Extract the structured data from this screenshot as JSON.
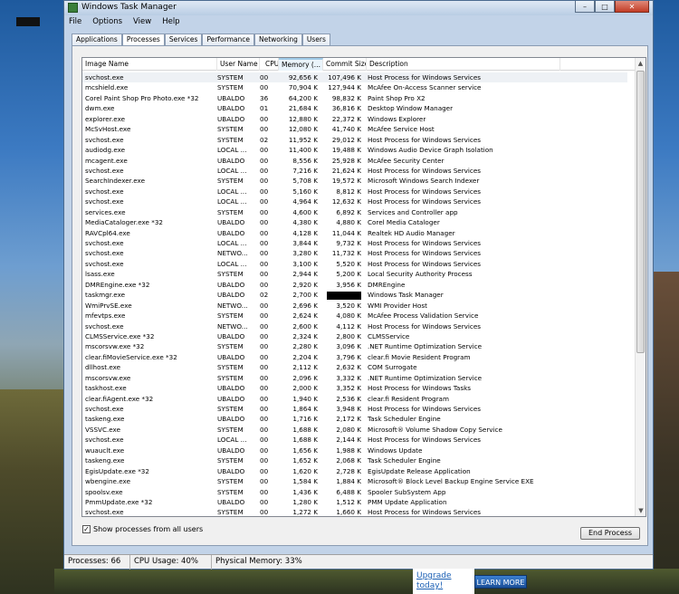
{
  "window": {
    "title": "Windows Task Manager"
  },
  "menu": [
    "File",
    "Options",
    "View",
    "Help"
  ],
  "tabs": [
    "Applications",
    "Processes",
    "Services",
    "Performance",
    "Networking",
    "Users"
  ],
  "active_tab": "Processes",
  "columns": [
    "Image Name",
    "User Name",
    "CPU",
    "Memory (...",
    "Commit Size",
    "Description"
  ],
  "processes": [
    {
      "name": "svchost.exe",
      "user": "SYSTEM",
      "cpu": "00",
      "mem": "92,656 K",
      "commit": "107,496 K",
      "desc": "Host Process for Windows Services"
    },
    {
      "name": "mcshield.exe",
      "user": "SYSTEM",
      "cpu": "00",
      "mem": "70,904 K",
      "commit": "127,944 K",
      "desc": "McAfee On-Access Scanner service"
    },
    {
      "name": "Corel Paint Shop Pro Photo.exe *32",
      "user": "UBALDO",
      "cpu": "36",
      "mem": "64,200 K",
      "commit": "98,832 K",
      "desc": "Paint Shop Pro X2"
    },
    {
      "name": "dwm.exe",
      "user": "UBALDO",
      "cpu": "01",
      "mem": "21,684 K",
      "commit": "36,816 K",
      "desc": "Desktop Window Manager"
    },
    {
      "name": "explorer.exe",
      "user": "UBALDO",
      "cpu": "00",
      "mem": "12,880 K",
      "commit": "22,372 K",
      "desc": "Windows Explorer"
    },
    {
      "name": "McSvHost.exe",
      "user": "SYSTEM",
      "cpu": "00",
      "mem": "12,080 K",
      "commit": "41,740 K",
      "desc": "McAfee Service Host"
    },
    {
      "name": "svchost.exe",
      "user": "SYSTEM",
      "cpu": "02",
      "mem": "11,952 K",
      "commit": "29,012 K",
      "desc": "Host Process for Windows Services"
    },
    {
      "name": "audiodg.exe",
      "user": "LOCAL ...",
      "cpu": "00",
      "mem": "11,400 K",
      "commit": "19,488 K",
      "desc": "Windows Audio Device Graph Isolation"
    },
    {
      "name": "mcagent.exe",
      "user": "UBALDO",
      "cpu": "00",
      "mem": "8,556 K",
      "commit": "25,928 K",
      "desc": "McAfee Security Center"
    },
    {
      "name": "svchost.exe",
      "user": "LOCAL ...",
      "cpu": "00",
      "mem": "7,216 K",
      "commit": "21,624 K",
      "desc": "Host Process for Windows Services"
    },
    {
      "name": "SearchIndexer.exe",
      "user": "SYSTEM",
      "cpu": "00",
      "mem": "5,708 K",
      "commit": "19,572 K",
      "desc": "Microsoft Windows Search Indexer"
    },
    {
      "name": "svchost.exe",
      "user": "LOCAL ...",
      "cpu": "00",
      "mem": "5,160 K",
      "commit": "8,812 K",
      "desc": "Host Process for Windows Services"
    },
    {
      "name": "svchost.exe",
      "user": "LOCAL ...",
      "cpu": "00",
      "mem": "4,964 K",
      "commit": "12,632 K",
      "desc": "Host Process for Windows Services"
    },
    {
      "name": "services.exe",
      "user": "SYSTEM",
      "cpu": "00",
      "mem": "4,600 K",
      "commit": "6,892 K",
      "desc": "Services and Controller app"
    },
    {
      "name": "MediaCataloger.exe *32",
      "user": "UBALDO",
      "cpu": "00",
      "mem": "4,380 K",
      "commit": "4,880 K",
      "desc": "Corel Media Cataloger"
    },
    {
      "name": "RAVCpl64.exe",
      "user": "UBALDO",
      "cpu": "00",
      "mem": "4,128 K",
      "commit": "11,044 K",
      "desc": "Realtek HD Audio Manager"
    },
    {
      "name": "svchost.exe",
      "user": "LOCAL ...",
      "cpu": "00",
      "mem": "3,844 K",
      "commit": "9,732 K",
      "desc": "Host Process for Windows Services"
    },
    {
      "name": "svchost.exe",
      "user": "NETWO...",
      "cpu": "00",
      "mem": "3,280 K",
      "commit": "11,732 K",
      "desc": "Host Process for Windows Services"
    },
    {
      "name": "svchost.exe",
      "user": "LOCAL ...",
      "cpu": "00",
      "mem": "3,100 K",
      "commit": "5,520 K",
      "desc": "Host Process for Windows Services"
    },
    {
      "name": "lsass.exe",
      "user": "SYSTEM",
      "cpu": "00",
      "mem": "2,944 K",
      "commit": "5,200 K",
      "desc": "Local Security Authority Process"
    },
    {
      "name": "DMREngine.exe *32",
      "user": "UBALDO",
      "cpu": "00",
      "mem": "2,920 K",
      "commit": "3,956 K",
      "desc": "DMREngine"
    },
    {
      "name": "taskmgr.exe",
      "user": "UBALDO",
      "cpu": "02",
      "mem": "2,700 K",
      "commit": "",
      "redacted": true,
      "desc": "Windows Task Manager"
    },
    {
      "name": "WmiPrvSE.exe",
      "user": "NETWO...",
      "cpu": "00",
      "mem": "2,696 K",
      "commit": "3,520 K",
      "desc": "WMI Provider Host"
    },
    {
      "name": "mfevtps.exe",
      "user": "SYSTEM",
      "cpu": "00",
      "mem": "2,624 K",
      "commit": "4,080 K",
      "desc": "McAfee Process Validation Service"
    },
    {
      "name": "svchost.exe",
      "user": "NETWO...",
      "cpu": "00",
      "mem": "2,600 K",
      "commit": "4,112 K",
      "desc": "Host Process for Windows Services"
    },
    {
      "name": "CLMSService.exe *32",
      "user": "UBALDO",
      "cpu": "00",
      "mem": "2,324 K",
      "commit": "2,800 K",
      "desc": "CLMSService"
    },
    {
      "name": "mscorsvw.exe *32",
      "user": "SYSTEM",
      "cpu": "00",
      "mem": "2,280 K",
      "commit": "3,096 K",
      "desc": ".NET Runtime Optimization Service"
    },
    {
      "name": "clear.fiMovieService.exe *32",
      "user": "UBALDO",
      "cpu": "00",
      "mem": "2,204 K",
      "commit": "3,796 K",
      "desc": "clear.fi Movie Resident Program"
    },
    {
      "name": "dllhost.exe",
      "user": "SYSTEM",
      "cpu": "00",
      "mem": "2,112 K",
      "commit": "2,632 K",
      "desc": "COM Surrogate"
    },
    {
      "name": "mscorsvw.exe",
      "user": "SYSTEM",
      "cpu": "00",
      "mem": "2,096 K",
      "commit": "3,332 K",
      "desc": ".NET Runtime Optimization Service"
    },
    {
      "name": "taskhost.exe",
      "user": "UBALDO",
      "cpu": "00",
      "mem": "2,000 K",
      "commit": "3,352 K",
      "desc": "Host Process for Windows Tasks"
    },
    {
      "name": "clear.fiAgent.exe *32",
      "user": "UBALDO",
      "cpu": "00",
      "mem": "1,940 K",
      "commit": "2,536 K",
      "desc": "clear.fi Resident Program"
    },
    {
      "name": "svchost.exe",
      "user": "SYSTEM",
      "cpu": "00",
      "mem": "1,864 K",
      "commit": "3,948 K",
      "desc": "Host Process for Windows Services"
    },
    {
      "name": "taskeng.exe",
      "user": "UBALDO",
      "cpu": "00",
      "mem": "1,716 K",
      "commit": "2,172 K",
      "desc": "Task Scheduler Engine"
    },
    {
      "name": "VSSVC.exe",
      "user": "SYSTEM",
      "cpu": "00",
      "mem": "1,688 K",
      "commit": "2,080 K",
      "desc": "Microsoft® Volume Shadow Copy Service"
    },
    {
      "name": "svchost.exe",
      "user": "LOCAL ...",
      "cpu": "00",
      "mem": "1,688 K",
      "commit": "2,144 K",
      "desc": "Host Process for Windows Services"
    },
    {
      "name": "wuauclt.exe",
      "user": "UBALDO",
      "cpu": "00",
      "mem": "1,656 K",
      "commit": "1,988 K",
      "desc": "Windows Update"
    },
    {
      "name": "taskeng.exe",
      "user": "SYSTEM",
      "cpu": "00",
      "mem": "1,652 K",
      "commit": "2,068 K",
      "desc": "Task Scheduler Engine"
    },
    {
      "name": "EgisUpdate.exe *32",
      "user": "UBALDO",
      "cpu": "00",
      "mem": "1,620 K",
      "commit": "2,728 K",
      "desc": "EgisUpdate Release Application"
    },
    {
      "name": "wbengine.exe",
      "user": "SYSTEM",
      "cpu": "00",
      "mem": "1,584 K",
      "commit": "1,884 K",
      "desc": "Microsoft® Block Level Backup Engine Service EXE"
    },
    {
      "name": "spoolsv.exe",
      "user": "SYSTEM",
      "cpu": "00",
      "mem": "1,436 K",
      "commit": "6,488 K",
      "desc": "Spooler SubSystem App"
    },
    {
      "name": "PmmUpdate.exe *32",
      "user": "UBALDO",
      "cpu": "00",
      "mem": "1,280 K",
      "commit": "1,512 K",
      "desc": "PMM Update Application"
    },
    {
      "name": "svchost.exe",
      "user": "SYSTEM",
      "cpu": "00",
      "mem": "1,272 K",
      "commit": "1,660 K",
      "desc": "Host Process for Windows Services"
    }
  ],
  "show_all_label": "Show processes from all users",
  "show_all_checked": true,
  "end_process_label": "End Process",
  "status": {
    "processes": "Processes: 66",
    "cpu": "CPU Usage: 40%",
    "memory": "Physical Memory: 33%"
  },
  "ad": {
    "upgrade_text": "Upgrade today!",
    "button_text": "LEARN MORE"
  },
  "icons": {
    "app": "task-manager-icon",
    "minimize": "minimize-icon",
    "maximize": "maximize-icon",
    "close": "close-icon"
  }
}
